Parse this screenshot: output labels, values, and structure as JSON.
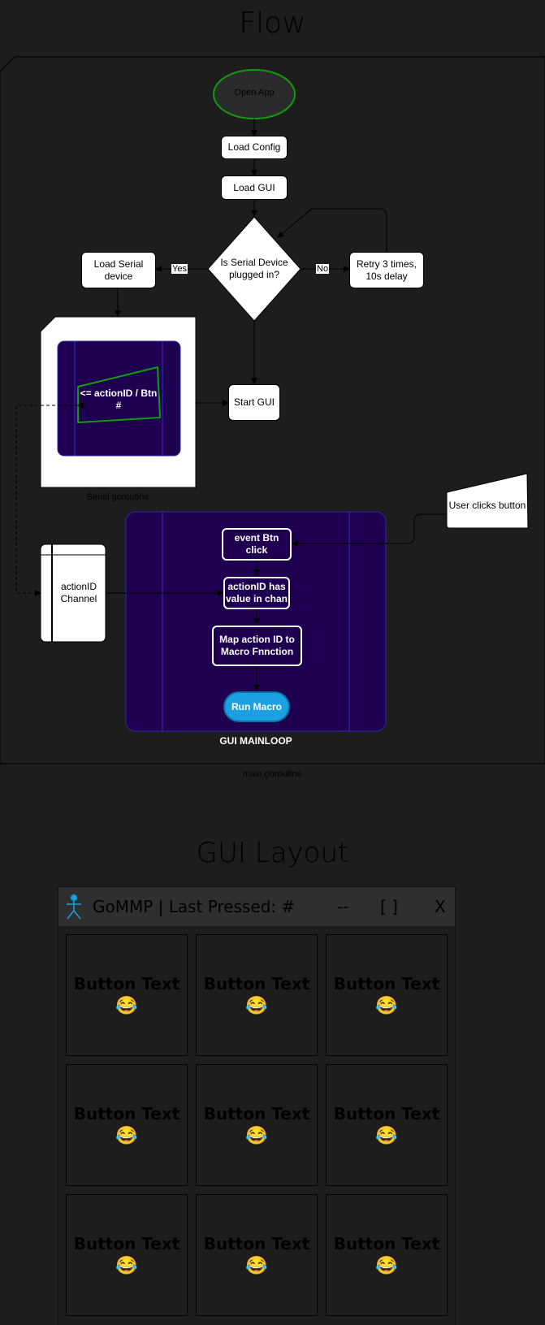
{
  "flow": {
    "title": "Flow",
    "nodes": {
      "open_app": "Open App",
      "load_config": "Load Config",
      "load_gui": "Load GUI",
      "decision": "Is Serial Device plugged in?",
      "load_serial": "Load Serial device",
      "retry": "Retry 3 times, 10s delay",
      "start_gui": "Start GUI",
      "serial_action": "<= actionID / Btn #",
      "user_clicks": "User clicks button",
      "action_channel": "actionID Channel",
      "event_btn": "event Btn click",
      "action_value": "actionID has value in chan",
      "map_action": "Map action ID to Macro Fnnction",
      "run_macro": "Run Macro"
    },
    "edge_labels": {
      "yes": "Yes",
      "no": "No"
    },
    "captions": {
      "serial_goroutine": "Serial goroutine",
      "gui_mainloop": "GUI MAINLOOP",
      "main_goroutine": "main goroutine"
    },
    "colors": {
      "background": "#1d1d1d",
      "purple": "#1f0050",
      "green": "#0f9d0f",
      "run_macro": "#1ba1e2"
    }
  },
  "gui_layout": {
    "title": "GUI Layout",
    "window": {
      "icon": "stick-figure-icon",
      "title": "GoMMP | Last Pressed: #",
      "minimize": "--",
      "maximize": "[ ]",
      "close": "X"
    },
    "buttons": [
      {
        "label": "Button Text",
        "emoji": "😂"
      },
      {
        "label": "Button Text",
        "emoji": "😂"
      },
      {
        "label": "Button Text",
        "emoji": "😂"
      },
      {
        "label": "Button Text",
        "emoji": "😂"
      },
      {
        "label": "Button Text",
        "emoji": "😂"
      },
      {
        "label": "Button Text",
        "emoji": "😂"
      },
      {
        "label": "Button Text",
        "emoji": "😂"
      },
      {
        "label": "Button Text",
        "emoji": "😂"
      },
      {
        "label": "Button Text",
        "emoji": "😂"
      }
    ]
  }
}
